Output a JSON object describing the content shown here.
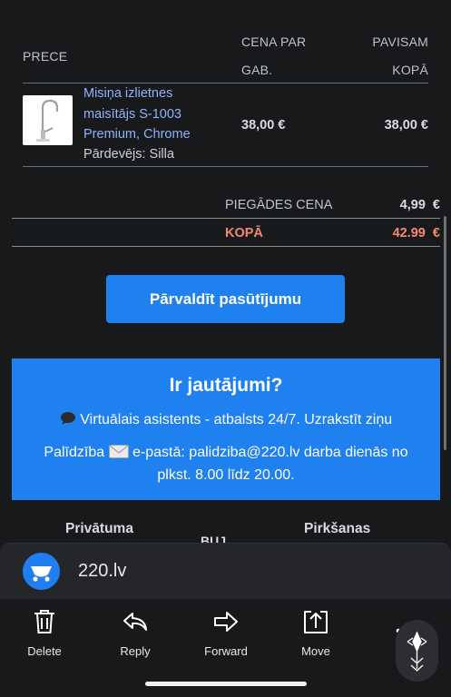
{
  "table": {
    "col_product": "PRECE",
    "col_unit_price_line1": "CENA PAR",
    "col_unit_price_line2": "GAB.",
    "col_total_line1": "PAVISAM",
    "col_total_line2": "KOPĀ"
  },
  "item": {
    "name_line1": "Misiņa izlietnes",
    "name_line2": "maisītājs S-1003",
    "name_line3": "Premium, Chrome",
    "seller": "Pārdevējs: Silla",
    "unit_price": "38,00 €",
    "total_price": "38,00 €"
  },
  "summary": {
    "shipping_label": "PIEGĀDES CENA",
    "shipping_value": "4,99  €",
    "total_label": "KOPĀ",
    "total_value": "42.99  €",
    "total_color": "#f28a72"
  },
  "actions": {
    "manage_order": "Pārvaldīt pasūtījumu"
  },
  "help": {
    "title": "Ir jautājumi?",
    "assistant_line": "Virtuālais asistents - atbalsts 24/7. Uzrakstīt ziņu",
    "email_line_prefix": "Palīdzība",
    "email_line_suffix": "e-pastā: palidziba@220.lv darba dienās no plkst. 8.00 līdz 20.00.",
    "accent_color": "#1f80f0"
  },
  "footer": {
    "privacy": "Privātuma",
    "middle": "BUJ",
    "purchase": "Pirkšanas"
  },
  "sender": {
    "name": "220.lv",
    "icon": "cart-logo-icon"
  },
  "toolbar": {
    "delete": "Delete",
    "reply": "Reply",
    "forward": "Forward",
    "move": "Move",
    "more": "M"
  }
}
